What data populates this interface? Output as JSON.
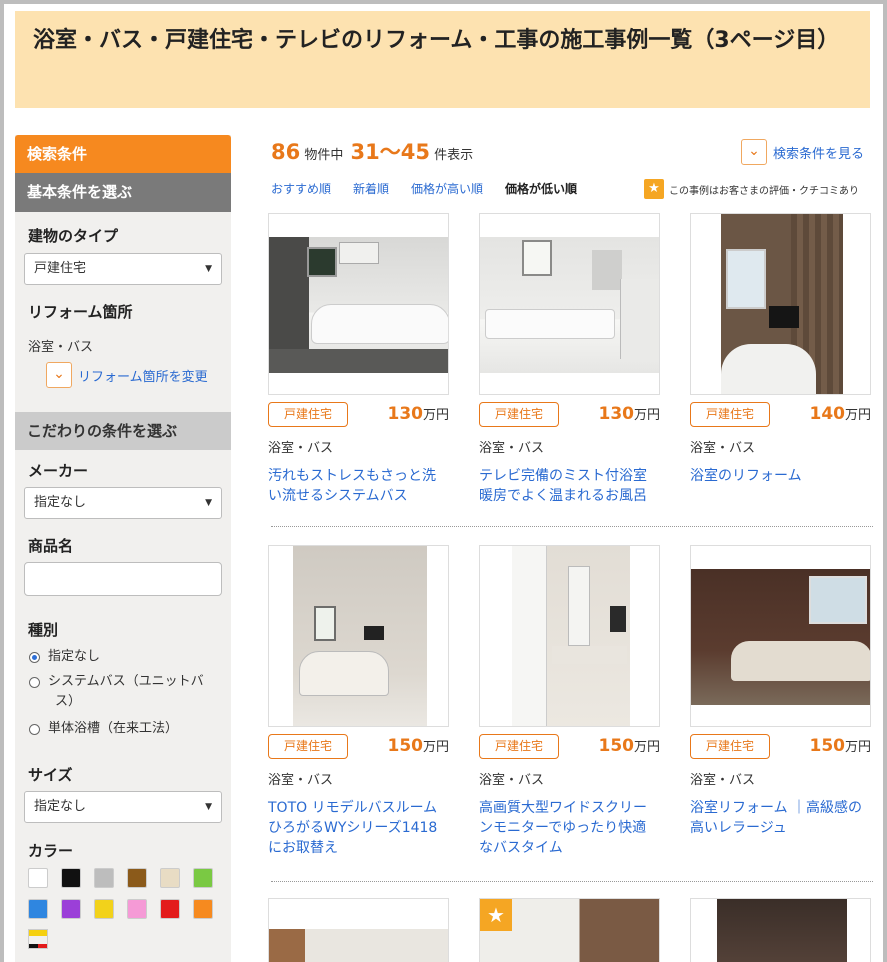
{
  "page_title": "浴室・バス・戸建住宅・テレビのリフォーム・工事の施工事例一覧（3ページ目）",
  "sidebar": {
    "header": "検索条件",
    "basic_section": "基本条件を選ぶ",
    "building_type_label": "建物のタイプ",
    "building_type_value": "戸建住宅",
    "reform_area_label": "リフォーム箇所",
    "reform_area_value": "浴室・バス",
    "change_area_link": "リフォーム箇所を変更",
    "detail_section": "こだわりの条件を選ぶ",
    "maker_label": "メーカー",
    "maker_value": "指定なし",
    "product_label": "商品名",
    "product_value": "",
    "kind_label": "種別",
    "kind_options": [
      "指定なし",
      "システムバス（ユニットバ",
      "ス）",
      "単体浴槽（在来工法）"
    ],
    "size_label": "サイズ",
    "size_value": "指定なし",
    "color_label": "カラー",
    "colors": [
      "#ffffff",
      "#111111",
      "#bdbdbd",
      "#8b5a1a",
      "#e8dcc4",
      "#7ac943",
      "#2f86e0",
      "#9b3fd8",
      "#f2d21b",
      "#f59ad6",
      "#e31b1b",
      "#f68a1f"
    ]
  },
  "results": {
    "total": "86",
    "total_suffix": "物件中",
    "range": "31〜45",
    "range_suffix": "件表示",
    "view_conditions": "検索条件を見る",
    "sorts": [
      "おすすめ順",
      "新着順",
      "価格が高い順",
      "価格が低い順"
    ],
    "active_sort": "価格が低い順",
    "rating_note": "この事例はお客さまの評価・クチコミあり"
  },
  "cards": [
    {
      "badge": "戸建住宅",
      "price": "130",
      "unit": "万円",
      "category": "浴室・バス",
      "title": "汚れもストレスもさっと洗い流せるシステムバス"
    },
    {
      "badge": "戸建住宅",
      "price": "130",
      "unit": "万円",
      "category": "浴室・バス",
      "title": "テレビ完備のミスト付浴室暖房でよく温まれるお風呂"
    },
    {
      "badge": "戸建住宅",
      "price": "140",
      "unit": "万円",
      "category": "浴室・バス",
      "title": "浴室のリフォーム"
    },
    {
      "badge": "戸建住宅",
      "price": "150",
      "unit": "万円",
      "category": "浴室・バス",
      "title": "TOTO リモデルバスルーム ひろがるWYシリーズ1418にお取替え"
    },
    {
      "badge": "戸建住宅",
      "price": "150",
      "unit": "万円",
      "category": "浴室・バス",
      "title": "高画質大型ワイドスクリーンモニターでゆったり快適なバスタイム"
    },
    {
      "badge": "戸建住宅",
      "price": "150",
      "unit": "万円",
      "category": "浴室・バス",
      "title": "浴室リフォーム ｜高級感の高いレラージュ"
    }
  ]
}
